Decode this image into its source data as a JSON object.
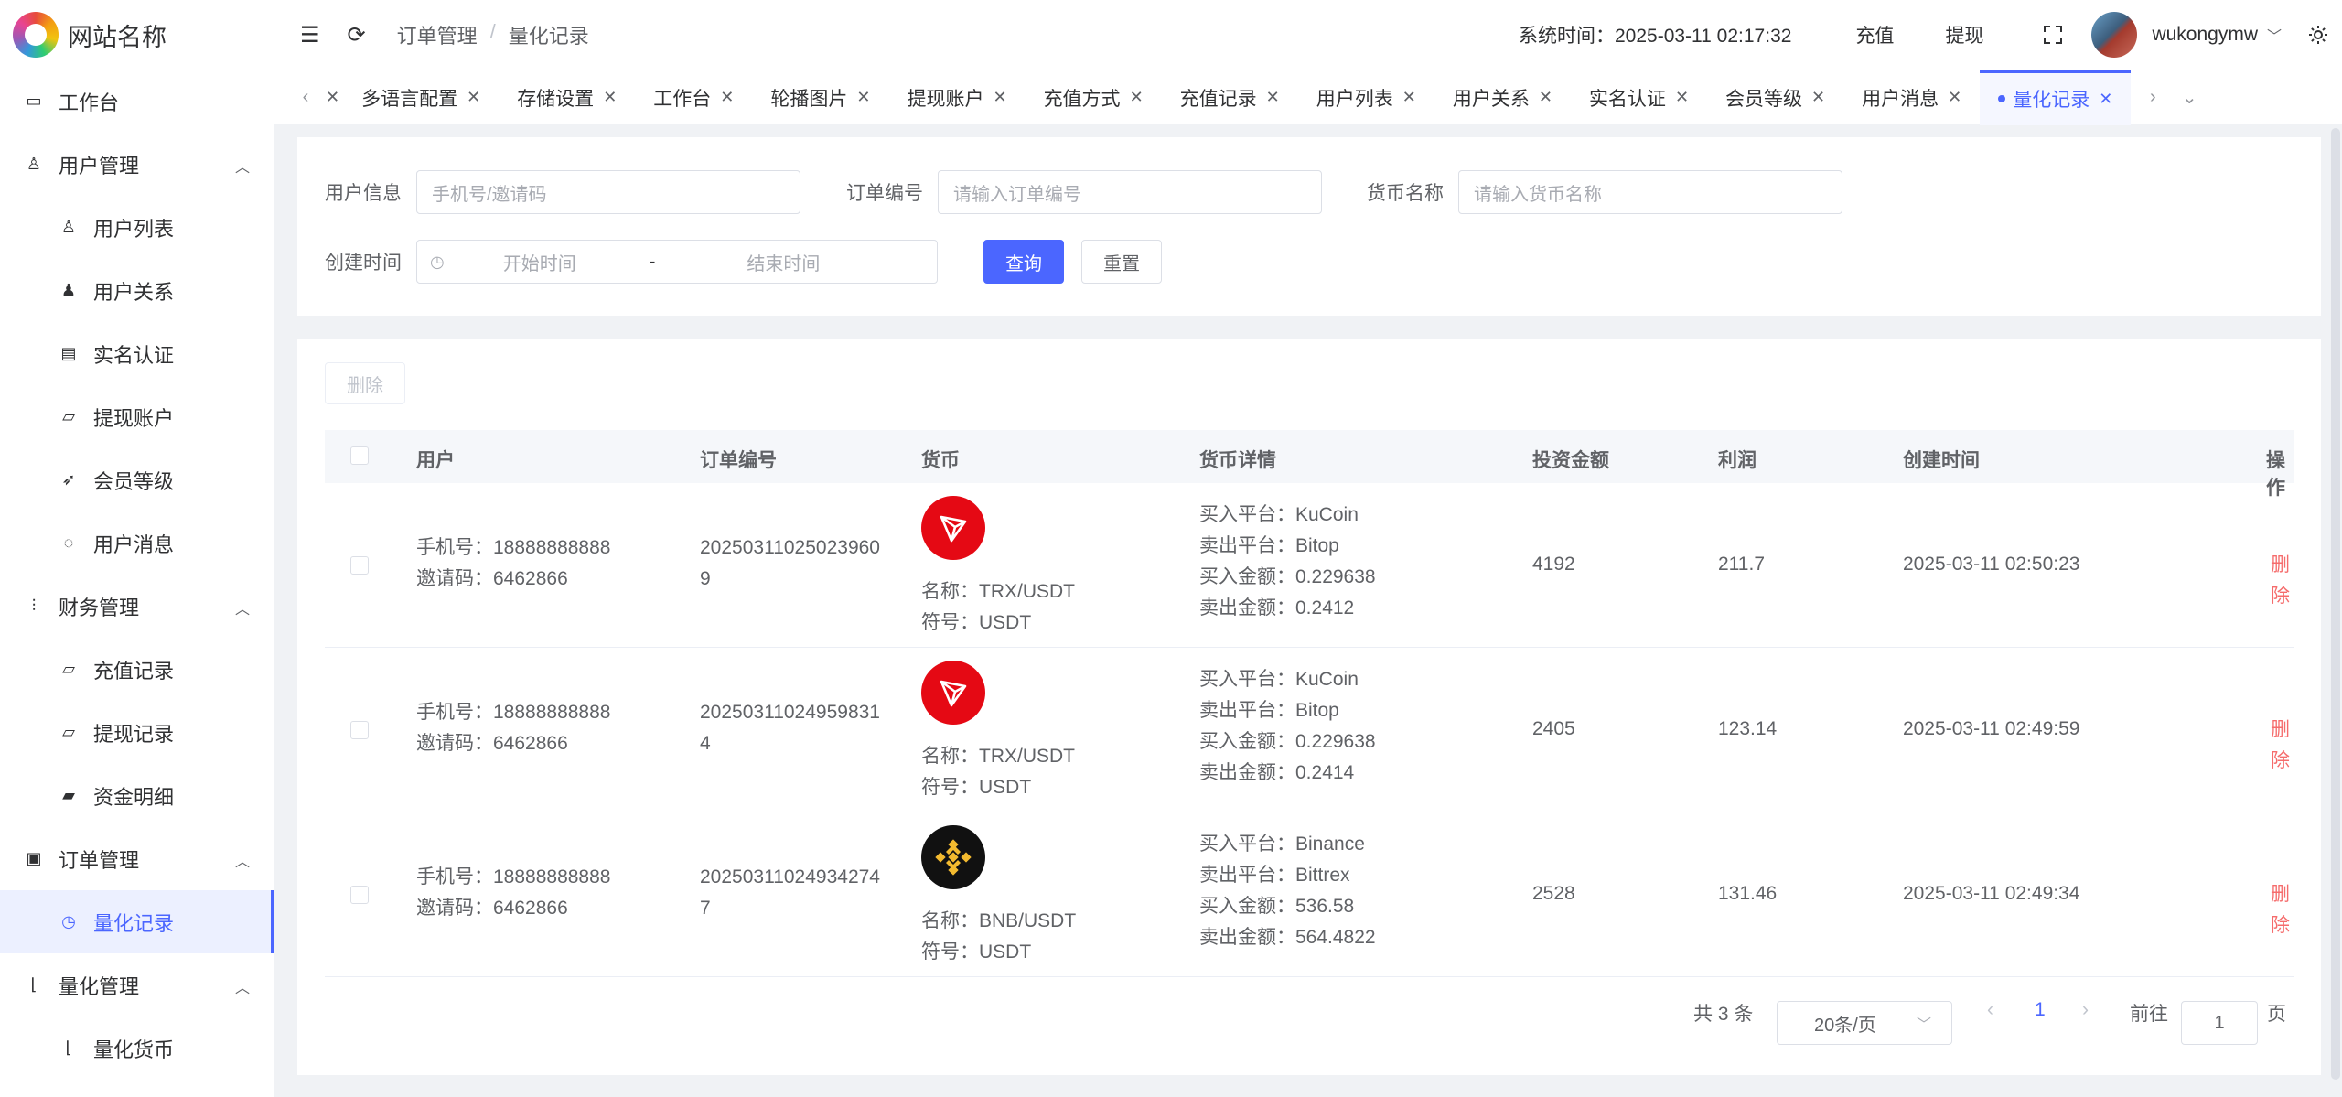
{
  "app": {
    "name": "网站名称"
  },
  "sidebar": {
    "items": [
      {
        "label": "工作台",
        "icon": "monitor-icon",
        "type": "top"
      },
      {
        "label": "用户管理",
        "icon": "user-icon",
        "type": "group"
      },
      {
        "label": "用户列表",
        "icon": "user-list-icon",
        "type": "sub"
      },
      {
        "label": "用户关系",
        "icon": "users-icon",
        "type": "sub"
      },
      {
        "label": "实名认证",
        "icon": "id-card-icon",
        "type": "sub"
      },
      {
        "label": "提现账户",
        "icon": "folder-icon",
        "type": "sub"
      },
      {
        "label": "会员等级",
        "icon": "rocket-icon",
        "type": "sub"
      },
      {
        "label": "用户消息",
        "icon": "chat-icon",
        "type": "sub"
      },
      {
        "label": "财务管理",
        "icon": "chart-icon",
        "type": "group"
      },
      {
        "label": "充值记录",
        "icon": "folder-icon",
        "type": "sub"
      },
      {
        "label": "提现记录",
        "icon": "folder-icon",
        "type": "sub"
      },
      {
        "label": "资金明细",
        "icon": "wallet-icon",
        "type": "sub"
      },
      {
        "label": "订单管理",
        "icon": "order-icon",
        "type": "group"
      },
      {
        "label": "量化记录",
        "icon": "clock-icon",
        "type": "sub",
        "active": true
      },
      {
        "label": "量化管理",
        "icon": "stairs-icon",
        "type": "group"
      },
      {
        "label": "量化货币",
        "icon": "stairs-icon",
        "type": "sub"
      }
    ]
  },
  "header": {
    "breadcrumb": [
      "订单管理",
      "量化记录"
    ],
    "system_time": "系统时间：2025-03-11 02:17:32",
    "recharge": "充值",
    "withdraw": "提现",
    "username": "wukongymw"
  },
  "tabs": [
    {
      "label": "多语言配置"
    },
    {
      "label": "存储设置"
    },
    {
      "label": "工作台"
    },
    {
      "label": "轮播图片"
    },
    {
      "label": "提现账户"
    },
    {
      "label": "充值方式"
    },
    {
      "label": "充值记录"
    },
    {
      "label": "用户列表"
    },
    {
      "label": "用户关系"
    },
    {
      "label": "实名认证"
    },
    {
      "label": "会员等级"
    },
    {
      "label": "用户消息"
    },
    {
      "label": "量化记录",
      "active": true
    }
  ],
  "search": {
    "user_info_label": "用户信息",
    "user_info_placeholder": "手机号/邀请码",
    "order_no_label": "订单编号",
    "order_no_placeholder": "请输入订单编号",
    "coin_name_label": "货币名称",
    "coin_name_placeholder": "请输入货币名称",
    "created_label": "创建时间",
    "start_placeholder": "开始时间",
    "range_sep": "-",
    "end_placeholder": "结束时间",
    "query": "查询",
    "reset": "重置"
  },
  "table": {
    "delete_button": "删除",
    "columns": [
      "用户",
      "订单编号",
      "货币",
      "货币详情",
      "投资金额",
      "利润",
      "创建时间",
      "操作"
    ],
    "rows": [
      {
        "phone": "手机号：18888888888",
        "invite": "邀请码：6462866",
        "order_no_1": "20250311025023960",
        "order_no_2": "9",
        "coin_icon": "tron-icon",
        "coin_color": "#e50914",
        "coin_name": "名称：TRX/USDT",
        "coin_symbol": "符号：USDT",
        "buy_platform": "买入平台：KuCoin",
        "sell_platform": "卖出平台：Bitop",
        "buy_amount": "买入金额：0.229638",
        "sell_amount": "卖出金额：0.2412",
        "invest": "4192",
        "profit": "211.7",
        "created": "2025-03-11 02:50:23",
        "action": "删除"
      },
      {
        "phone": "手机号：18888888888",
        "invite": "邀请码：6462866",
        "order_no_1": "20250311024959831",
        "order_no_2": "4",
        "coin_icon": "tron-icon",
        "coin_color": "#e50914",
        "coin_name": "名称：TRX/USDT",
        "coin_symbol": "符号：USDT",
        "buy_platform": "买入平台：KuCoin",
        "sell_platform": "卖出平台：Bitop",
        "buy_amount": "买入金额：0.229638",
        "sell_amount": "卖出金额：0.2414",
        "invest": "2405",
        "profit": "123.14",
        "created": "2025-03-11 02:49:59",
        "action": "删除"
      },
      {
        "phone": "手机号：18888888888",
        "invite": "邀请码：6462866",
        "order_no_1": "20250311024934274",
        "order_no_2": "7",
        "coin_icon": "binance-icon",
        "coin_color": "#111111",
        "coin_name": "名称：BNB/USDT",
        "coin_symbol": "符号：USDT",
        "buy_platform": "买入平台：Binance",
        "sell_platform": "卖出平台：Bittrex",
        "buy_amount": "买入金额：536.58",
        "sell_amount": "卖出金额：564.4822",
        "invest": "2528",
        "profit": "131.46",
        "created": "2025-03-11 02:49:34",
        "action": "删除"
      }
    ]
  },
  "pagination": {
    "total": "共 3 条",
    "page_size": "20条/页",
    "current": "1",
    "goto_label": "前往",
    "goto_value": "1",
    "page_unit": "页"
  },
  "colors": {
    "accent": "#4b66ff",
    "danger": "#f56c6c"
  }
}
